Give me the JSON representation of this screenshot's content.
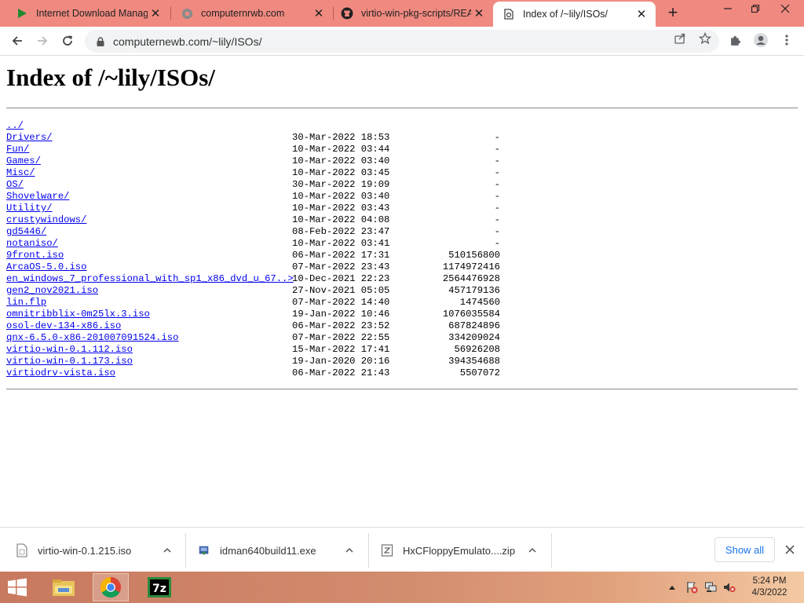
{
  "tabs": [
    {
      "title": "Internet Download Manager",
      "icon": "idm-play-icon"
    },
    {
      "title": "computernrwb.com",
      "icon": "globe-icon"
    },
    {
      "title": "virtio-win-pkg-scripts/README",
      "icon": "github-icon"
    },
    {
      "title": "Index of /~lily/ISOs/",
      "icon": "server-icon",
      "active": true
    }
  ],
  "address_bar": {
    "url": "computernewb.com/~lily/ISOs/"
  },
  "page": {
    "title": "Index of /~lily/ISOs/",
    "parent_link": "../",
    "entries": [
      {
        "name": "Drivers/",
        "date": "30-Mar-2022 18:53",
        "size": "-"
      },
      {
        "name": "Fun/",
        "date": "10-Mar-2022 03:44",
        "size": "-"
      },
      {
        "name": "Games/",
        "date": "10-Mar-2022 03:40",
        "size": "-"
      },
      {
        "name": "Misc/",
        "date": "10-Mar-2022 03:45",
        "size": "-"
      },
      {
        "name": "OS/",
        "date": "30-Mar-2022 19:09",
        "size": "-"
      },
      {
        "name": "Shovelware/",
        "date": "10-Mar-2022 03:40",
        "size": "-"
      },
      {
        "name": "Utility/",
        "date": "10-Mar-2022 03:43",
        "size": "-"
      },
      {
        "name": "crustywindows/",
        "date": "10-Mar-2022 04:08",
        "size": "-"
      },
      {
        "name": "gd5446/",
        "date": "08-Feb-2022 23:47",
        "size": "-"
      },
      {
        "name": "notaniso/",
        "date": "10-Mar-2022 03:41",
        "size": "-"
      },
      {
        "name": "9front.iso",
        "date": "06-Mar-2022 17:31",
        "size": "510156800"
      },
      {
        "name": "ArcaOS-5.0.iso",
        "date": "07-Mar-2022 23:43",
        "size": "1174972416"
      },
      {
        "name": "en_windows_7_professional_with_sp1_x86_dvd_u_67..>",
        "date": "10-Dec-2021 22:23",
        "size": "2564476928"
      },
      {
        "name": "gen2_nov2021.iso",
        "date": "27-Nov-2021 05:05",
        "size": "457179136"
      },
      {
        "name": "lin.flp",
        "date": "07-Mar-2022 14:40",
        "size": "1474560"
      },
      {
        "name": "omnitribblix-0m25lx.3.iso",
        "date": "19-Jan-2022 10:46",
        "size": "1076035584"
      },
      {
        "name": "osol-dev-134-x86.iso",
        "date": "06-Mar-2022 23:52",
        "size": "687824896"
      },
      {
        "name": "qnx-6.5.0-x86-201007091524.iso",
        "date": "07-Mar-2022 22:55",
        "size": "334209024"
      },
      {
        "name": "virtio-win-0.1.112.iso",
        "date": "15-Mar-2022 17:41",
        "size": "56926208"
      },
      {
        "name": "virtio-win-0.1.173.iso",
        "date": "19-Jan-2020 20:16",
        "size": "394354688"
      },
      {
        "name": "virtiodrv-vista.iso",
        "date": "06-Mar-2022 21:43",
        "size": "5507072"
      }
    ]
  },
  "downloads": {
    "items": [
      {
        "name": "virtio-win-0.1.215.iso",
        "icon": "file-icon"
      },
      {
        "name": "idman640build11.exe",
        "icon": "installer-icon"
      },
      {
        "name": "HxCFloppyEmulato....zip",
        "icon": "zip-icon"
      }
    ],
    "show_all_label": "Show all"
  },
  "taskbar": {
    "time": "5:24 PM",
    "date": "4/3/2022",
    "apps": [
      "file-explorer-icon",
      "chrome-icon",
      "7zip-icon"
    ]
  },
  "colors": {
    "titlebar": "#f08a80",
    "link": "#0000ee",
    "accent": "#1a73e8"
  }
}
